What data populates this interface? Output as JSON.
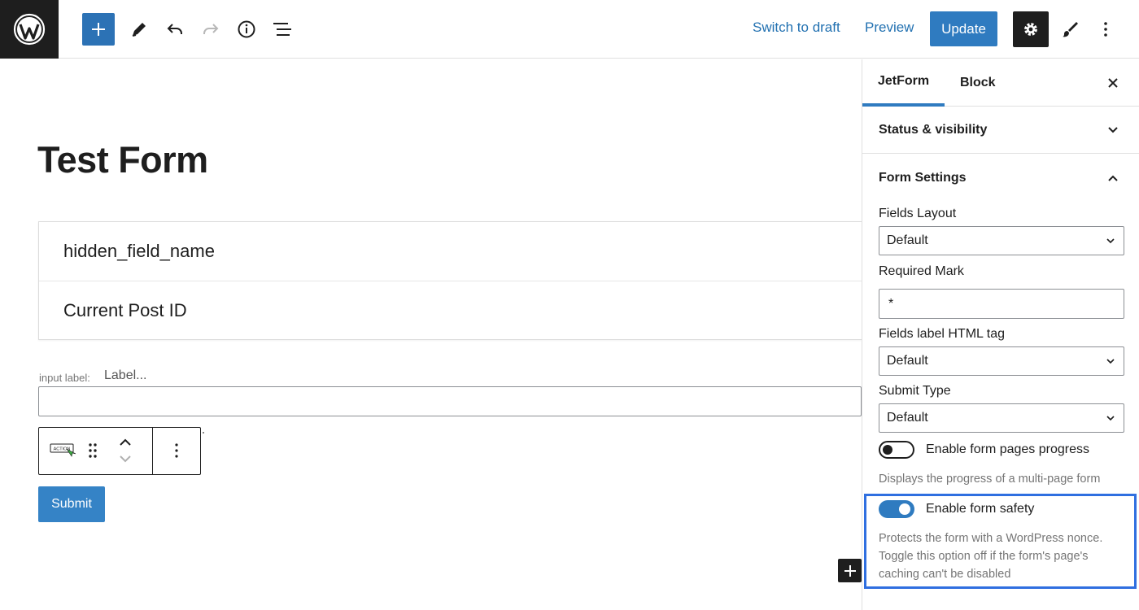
{
  "header": {
    "switch_to_draft": "Switch to draft",
    "preview": "Preview",
    "update": "Update"
  },
  "post": {
    "title": "Test Form",
    "fields": [
      "hidden_field_name",
      "Current Post ID"
    ],
    "input_label_caption": "input label:",
    "input_label_placeholder": "Label...",
    "action_badge": "ACTION",
    "submit_label": "Submit"
  },
  "sidebar": {
    "tabs": [
      "JetForm",
      "Block"
    ],
    "status_visibility": "Status & visibility",
    "form_settings": "Form Settings",
    "fields_layout_label": "Fields Layout",
    "fields_layout_value": "Default",
    "required_mark_label": "Required Mark",
    "required_mark_value": "*",
    "label_tag_label": "Fields label HTML tag",
    "label_tag_value": "Default",
    "submit_type_label": "Submit Type",
    "submit_type_value": "Default",
    "progress_toggle": {
      "label": "Enable form pages progress",
      "on": false,
      "help": "Displays the progress of a multi-page form"
    },
    "safety_toggle": {
      "label": "Enable form safety",
      "on": true,
      "help": "Protects the form with a WordPress nonce. Toggle this option off if the form's page's caching can't be disabled"
    }
  },
  "colors": {
    "accent": "#2f7bc0",
    "dark": "#1e1e1e",
    "highlight": "#2f6fe0"
  },
  "icons": [
    "wordpress-logo-icon",
    "plus-icon",
    "pencil-icon",
    "undo-icon",
    "redo-icon",
    "info-icon",
    "list-view-icon",
    "gear-icon",
    "brush-icon",
    "more-vertical-icon",
    "close-icon",
    "chevron-down-icon",
    "chevron-up-icon",
    "drag-handle-icon"
  ]
}
